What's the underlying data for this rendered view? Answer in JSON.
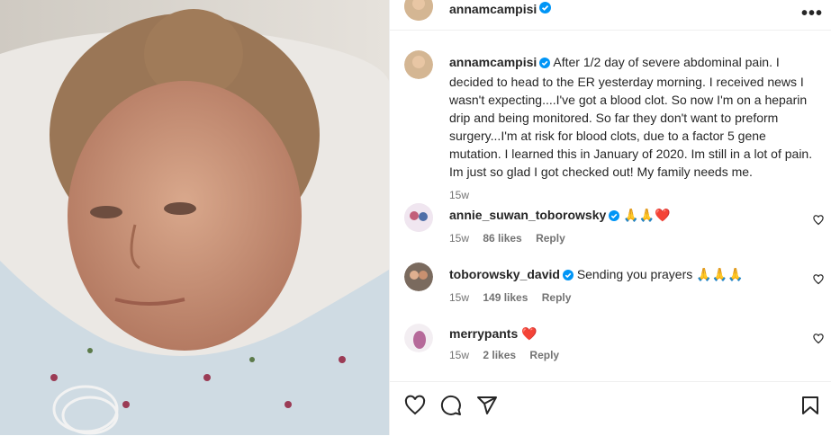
{
  "post": {
    "author": "annamcampisi",
    "caption": "After 1/2 day of severe abdominal pain. I decided to head to the ER yesterday morning. I received news I wasn't expecting....I've got a blood clot. So now I'm on a heparin drip and being monitored. So far they don't want to preform surgery...I'm at risk for blood clots, due to a factor 5 gene mutation. I learned this in January of 2020. Im still in a lot of pain. Im just so glad I got checked out! My family needs me.",
    "age": "15w"
  },
  "comments": [
    {
      "user": "annie_suwan_toborowsky",
      "verified": true,
      "text": "🙏🙏❤️",
      "age": "15w",
      "likes": "86 likes",
      "reply": "Reply"
    },
    {
      "user": "toborowsky_david",
      "verified": true,
      "text": "Sending you prayers 🙏🙏🙏",
      "age": "15w",
      "likes": "149 likes",
      "reply": "Reply"
    },
    {
      "user": "merrypants",
      "verified": false,
      "text": "❤️",
      "age": "15w",
      "likes": "2 likes",
      "reply": "Reply"
    }
  ],
  "icons": [
    "more-options-icon",
    "verified-badge-icon",
    "comment-heart-icon",
    "like-icon",
    "comment-icon",
    "share-icon",
    "save-icon"
  ],
  "colors": {
    "verified": "#0095f6",
    "text": "#262626",
    "muted": "#737373"
  }
}
